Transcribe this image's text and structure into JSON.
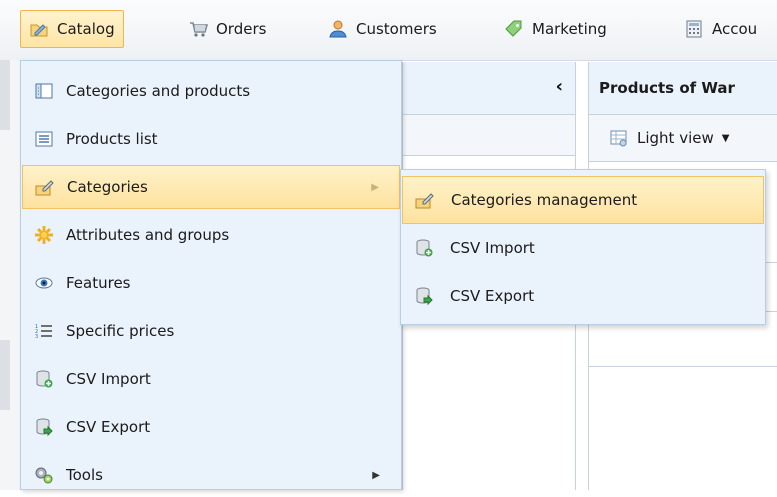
{
  "topnav": {
    "items": [
      {
        "label": "Catalog",
        "icon": "catalog-folder-icon",
        "active": true
      },
      {
        "label": "Orders",
        "icon": "orders-cart-icon"
      },
      {
        "label": "Customers",
        "icon": "customers-person-icon"
      },
      {
        "label": "Marketing",
        "icon": "marketing-tag-icon"
      },
      {
        "label": "Accou",
        "icon": "accounting-calculator-icon"
      }
    ]
  },
  "catalog_menu": {
    "items": [
      {
        "label": "Categories and products",
        "icon": "categories-tree-icon"
      },
      {
        "label": "Products list",
        "icon": "list-icon"
      },
      {
        "label": "Categories",
        "icon": "categories-edit-icon",
        "active": true,
        "has_submenu": true
      },
      {
        "label": "Attributes and groups",
        "icon": "attributes-icon"
      },
      {
        "label": "Features",
        "icon": "eye-icon"
      },
      {
        "label": "Specific prices",
        "icon": "numbered-list-icon"
      },
      {
        "label": "CSV Import",
        "icon": "db-import-icon"
      },
      {
        "label": "CSV Export",
        "icon": "db-export-icon"
      },
      {
        "label": "Tools",
        "icon": "gears-icon",
        "has_submenu": true
      }
    ]
  },
  "categories_submenu": {
    "items": [
      {
        "label": "Categories management",
        "icon": "categories-edit-icon",
        "active": true
      },
      {
        "label": "CSV Import",
        "icon": "db-import-icon"
      },
      {
        "label": "CSV Export",
        "icon": "db-export-icon"
      }
    ]
  },
  "left_panel": {
    "collapse_glyph": "‹"
  },
  "right_panel": {
    "title": "Products of War",
    "view_button": "Light view"
  },
  "colors": {
    "menu_bg": "#eaf2fb",
    "active_bg": "#fde5a6",
    "active_border": "#f2b54e"
  }
}
